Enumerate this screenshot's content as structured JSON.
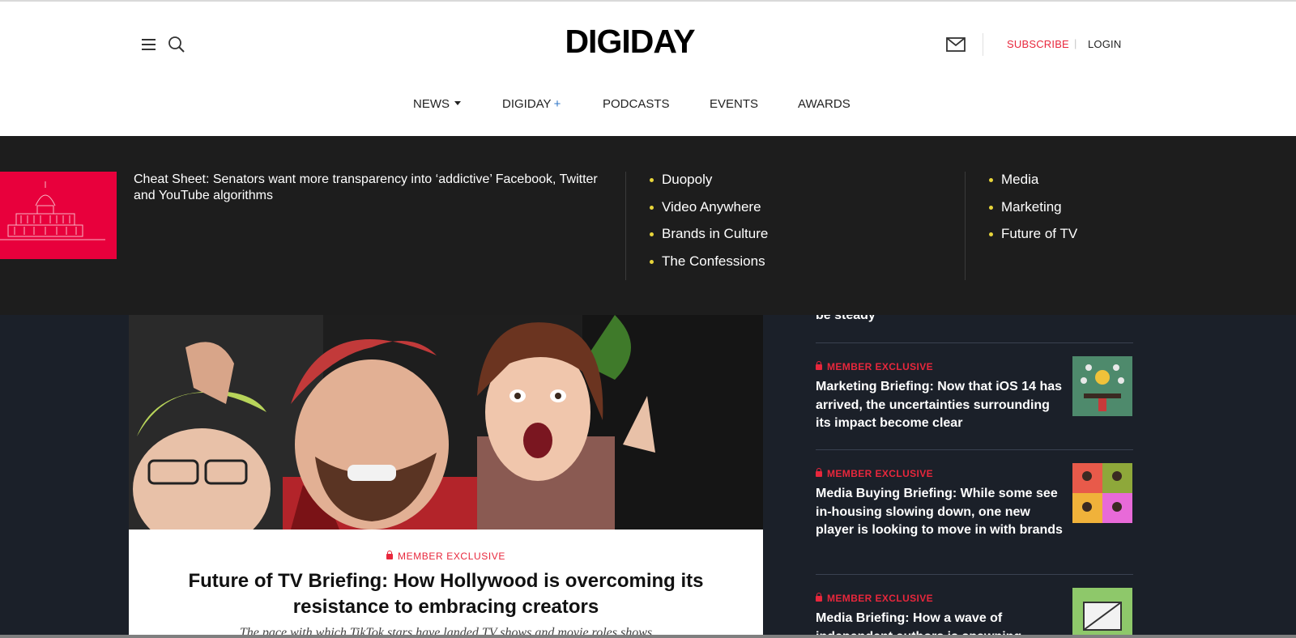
{
  "header": {
    "logo": "DIGIDAY",
    "subscribe": "SUBSCRIBE",
    "separator": "|",
    "login": "LOGIN"
  },
  "nav": {
    "news": "NEWS",
    "digiday": "DIGIDAY",
    "digiday_plus": "+",
    "podcasts": "PODCASTS",
    "events": "EVENTS",
    "awards": "AWARDS"
  },
  "mega_menu": {
    "feature_title": "Cheat Sheet: Senators want more transparency into ‘addictive’ Facebook, Twitter and YouTube algorithms",
    "topics_col1": [
      "Duopoly",
      "Video Anywhere",
      "Brands in Culture",
      "The Confessions"
    ],
    "topics_col2": [
      "Media",
      "Marketing",
      "Future of TV"
    ]
  },
  "main_story": {
    "badge": "MEMBER EXCLUSIVE",
    "title": "Future of TV Briefing: How Hollywood is overcoming its resistance to embracing creators",
    "dek": "The pace with which TikTok stars have landed TV shows and movie roles shows"
  },
  "side": {
    "partial_title": "be steady",
    "items": [
      {
        "badge": "MEMBER EXCLUSIVE",
        "title": "Marketing Briefing: Now that iOS 14 has arrived, the uncertainties surrounding its impact become clear"
      },
      {
        "badge": "MEMBER EXCLUSIVE",
        "title": "Media Buying Briefing: While some see in-housing slowing down, one new player is looking to move in with brands"
      },
      {
        "badge": "MEMBER EXCLUSIVE",
        "title": "Media Briefing: How a wave of independent authors is spawning"
      }
    ]
  },
  "colors": {
    "accent_red": "#e8273c",
    "bullet_yellow": "#e8d53a",
    "page_bg": "#1b2029",
    "mega_bg": "#1d1d1d"
  }
}
